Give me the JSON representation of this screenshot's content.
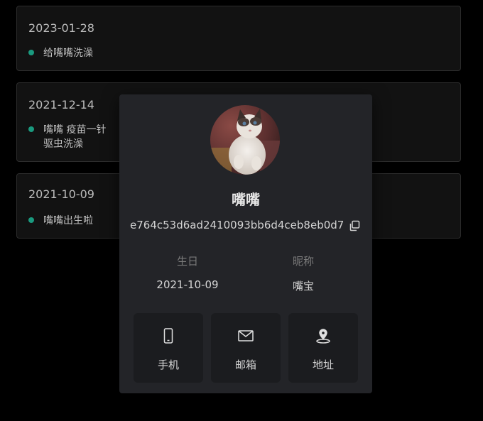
{
  "colors": {
    "dot": "#1a9a7f",
    "card_bg": "#121212",
    "popup_bg": "#232428",
    "action_bg": "#1b1c1f"
  },
  "timeline": [
    {
      "date": "2023-01-28",
      "entries": [
        "给嘴嘴洗澡"
      ]
    },
    {
      "date": "2021-12-14",
      "entries": [
        "嘴嘴 疫苗一针",
        "驱虫洗澡"
      ]
    },
    {
      "date": "2021-10-09",
      "entries": [
        "嘴嘴出生啦"
      ]
    }
  ],
  "profile": {
    "avatar": "cat-avatar",
    "name": "嘴嘴",
    "id": "e764c53d6ad2410093bb6d4ceb8eb0d7",
    "copy_icon": "copy-icon",
    "birthday_label": "生日",
    "birthday_value": "2021-10-09",
    "nickname_label": "昵称",
    "nickname_value": "嘴宝",
    "actions": [
      {
        "label": "手机",
        "icon": "phone-icon"
      },
      {
        "label": "邮箱",
        "icon": "mail-icon"
      },
      {
        "label": "地址",
        "icon": "location-pin-icon"
      }
    ]
  }
}
